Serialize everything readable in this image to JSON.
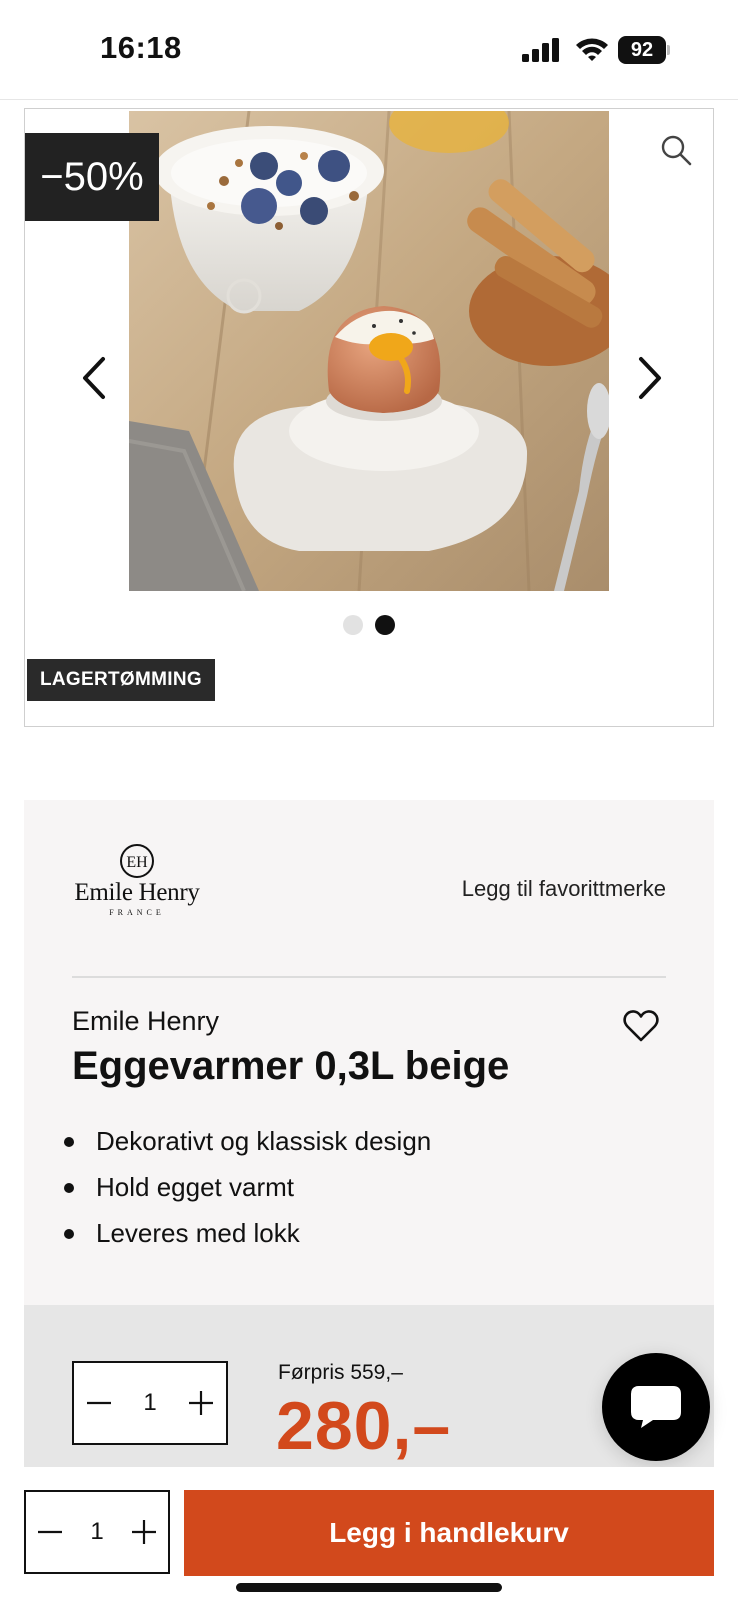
{
  "status_bar": {
    "time": "16:18",
    "battery": "92",
    "icons": [
      "signal-icon",
      "wifi-icon",
      "battery-icon"
    ]
  },
  "gallery": {
    "discount": "−50%",
    "stock_label": "LAGERTØMMING",
    "slide_count": 2,
    "active_slide": 2,
    "icons": [
      "search-icon",
      "chevron-left-icon",
      "chevron-right-icon"
    ]
  },
  "brand": {
    "logo_mark": "EH",
    "logo_name": "Emile Henry",
    "logo_country": "FRANCE",
    "favorite_label": "Legg til favorittmerke"
  },
  "product": {
    "brand": "Emile Henry",
    "title": "Eggevarmer 0,3L beige",
    "features": [
      "Dekorativt og klassisk design",
      "Hold egget varmt",
      "Leveres med lokk"
    ]
  },
  "pricing": {
    "quantity": "1",
    "old_price": "Førpris 559,–",
    "price": "280,–"
  },
  "bottom_bar": {
    "quantity": "1",
    "add_to_cart": "Legg i handlekurv"
  },
  "colors": {
    "accent": "#d2491c",
    "badge_bg": "#222222",
    "card_bg": "#f7f5f5",
    "panel_bg": "#e6e6e6"
  }
}
